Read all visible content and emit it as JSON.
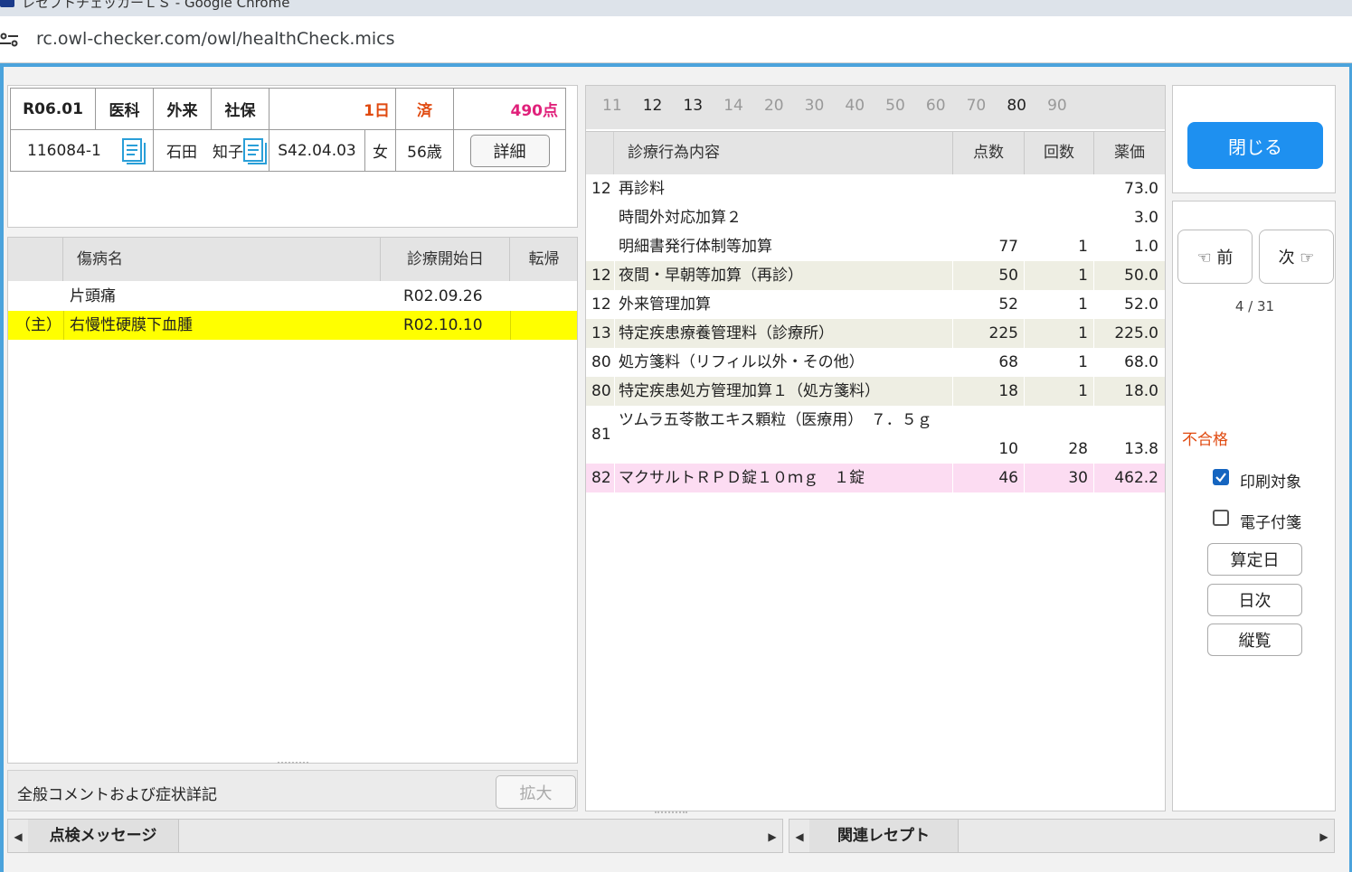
{
  "browser": {
    "window_title": "レセプトチェッカーＬＳ - Google Chrome",
    "url": "rc.owl-checker.com/owl/healthCheck.mics"
  },
  "header": {
    "month": "R06.01",
    "dept": "医科",
    "visit_type": "外来",
    "insurance": "社保",
    "days": "1日",
    "status": "済",
    "points": "490点",
    "patient_id": "116084-1",
    "patient_name": "石田　知子",
    "birth_date": "S42.04.03",
    "sex": "女",
    "age": "56歳",
    "detail_button": "詳細"
  },
  "diseases": {
    "columns": [
      "",
      "傷病名",
      "診療開始日",
      "転帰"
    ],
    "rows": [
      {
        "main": "",
        "name": "片頭痛",
        "start": "R02.09.26",
        "outcome": ""
      },
      {
        "main": "（主）",
        "name": "右慢性硬膜下血腫",
        "start": "R02.10.10",
        "outcome": ""
      }
    ]
  },
  "comment_section": {
    "label": "全般コメントおよび症状詳記",
    "expand_button": "拡大"
  },
  "category_tabs": [
    {
      "label": "11",
      "active": false
    },
    {
      "label": "12",
      "active": true
    },
    {
      "label": "13",
      "active": true
    },
    {
      "label": "14",
      "active": false
    },
    {
      "label": "20",
      "active": false
    },
    {
      "label": "30",
      "active": false
    },
    {
      "label": "40",
      "active": false
    },
    {
      "label": "50",
      "active": false
    },
    {
      "label": "60",
      "active": false
    },
    {
      "label": "70",
      "active": false
    },
    {
      "label": "80",
      "active": true
    },
    {
      "label": "90",
      "active": false
    }
  ],
  "acts": {
    "columns": [
      "診療行為内容",
      "点数",
      "回数",
      "薬価"
    ],
    "rows": [
      {
        "code": "12",
        "name": "再診料",
        "points": "",
        "count": "",
        "price": "73.0",
        "bg": "#ffffff"
      },
      {
        "code": "",
        "name": "時間外対応加算２",
        "points": "",
        "count": "",
        "price": "3.0",
        "bg": "#ffffff"
      },
      {
        "code": "",
        "name": "明細書発行体制等加算",
        "points": "77",
        "count": "1",
        "price": "1.0",
        "bg": "#ffffff"
      },
      {
        "code": "12",
        "name": "夜間・早朝等加算（再診）",
        "points": "50",
        "count": "1",
        "price": "50.0",
        "bg": "#eeeee3"
      },
      {
        "code": "12",
        "name": "外来管理加算",
        "points": "52",
        "count": "1",
        "price": "52.0",
        "bg": "#ffffff"
      },
      {
        "code": "13",
        "name": "特定疾患療養管理料（診療所）",
        "points": "225",
        "count": "1",
        "price": "225.0",
        "bg": "#eeeee3"
      },
      {
        "code": "80",
        "name": "処方箋料（リフィル以外・その他）",
        "points": "68",
        "count": "1",
        "price": "68.0",
        "bg": "#ffffff"
      },
      {
        "code": "80",
        "name": "特定疾患処方管理加算１（処方箋料）",
        "points": "18",
        "count": "1",
        "price": "18.0",
        "bg": "#eeeee3"
      },
      {
        "code": "81",
        "name": "ツムラ五苓散エキス顆粒（医療用）　７．５ｇ",
        "points": "10",
        "count": "28",
        "price": "13.8",
        "bg": "#ffffff"
      },
      {
        "code": "82",
        "name": "マクサルトＲＰＤ錠１０ｍｇ　１錠",
        "points": "46",
        "count": "30",
        "price": "462.2",
        "bg": "#fcdcf2"
      }
    ]
  },
  "side": {
    "close_button": "閉じる",
    "prev_button": "☜ 前",
    "next_button": "次 ☞",
    "page_indicator": "4 / 31",
    "result": "不合格",
    "print_target_label": "印刷対象",
    "print_target_checked": true,
    "e_attach_label": "電子付箋",
    "e_attach_checked": false,
    "calc_date_button": "算定日",
    "daily_button": "日次",
    "vertical_button": "縦覧"
  },
  "bottom": {
    "left_tab": "点検メッセージ",
    "right_tab": "関連レセプト"
  },
  "colors": {
    "accent_blue": "#1e90f0",
    "frame_blue": "#4ba3dc",
    "highlight_yellow": "#ffff00",
    "fail_red": "#e04a10",
    "points_pink": "#e0207a"
  }
}
